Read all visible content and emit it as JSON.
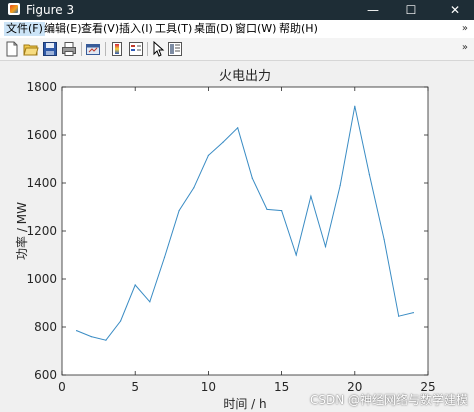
{
  "window": {
    "title": "Figure 3",
    "minimize_glyph": "—",
    "maximize_glyph": "☐",
    "close_glyph": "✕"
  },
  "menu": {
    "items": [
      "文件(F)",
      "编辑(E)",
      "查看(V)",
      "插入(I)",
      "工具(T)",
      "桌面(D)",
      "窗口(W)",
      "帮助(H)"
    ],
    "overflow_glyph": "»"
  },
  "toolbar": {
    "icons": [
      "new-figure-icon",
      "open-file-icon",
      "save-icon",
      "print-icon",
      "link-plot-icon",
      "colorbar-icon",
      "legend-icon",
      "pointer-icon",
      "property-editor-icon"
    ],
    "overflow_glyph": "»"
  },
  "watermark": "CSDN @神经网络与数学建模",
  "chart_data": {
    "type": "line",
    "title": "火电出力",
    "xlabel": "时间 / h",
    "ylabel": "功率 / MW",
    "xlim": [
      0,
      25
    ],
    "ylim": [
      600,
      1800
    ],
    "xticks": [
      0,
      5,
      10,
      15,
      20,
      25
    ],
    "yticks": [
      600,
      800,
      1000,
      1200,
      1400,
      1600,
      1800
    ],
    "grid": false,
    "line_color": "#3a8cc4",
    "x": [
      1,
      2,
      3,
      4,
      5,
      6,
      7,
      8,
      9,
      10,
      11,
      12,
      13,
      14,
      15,
      16,
      17,
      18,
      19,
      20,
      21,
      22,
      23,
      24
    ],
    "y": [
      785,
      760,
      745,
      825,
      975,
      905,
      1090,
      1285,
      1380,
      1515,
      1570,
      1630,
      1420,
      1290,
      1285,
      1100,
      1345,
      1135,
      1390,
      1720,
      1435,
      1165,
      845,
      860
    ]
  }
}
